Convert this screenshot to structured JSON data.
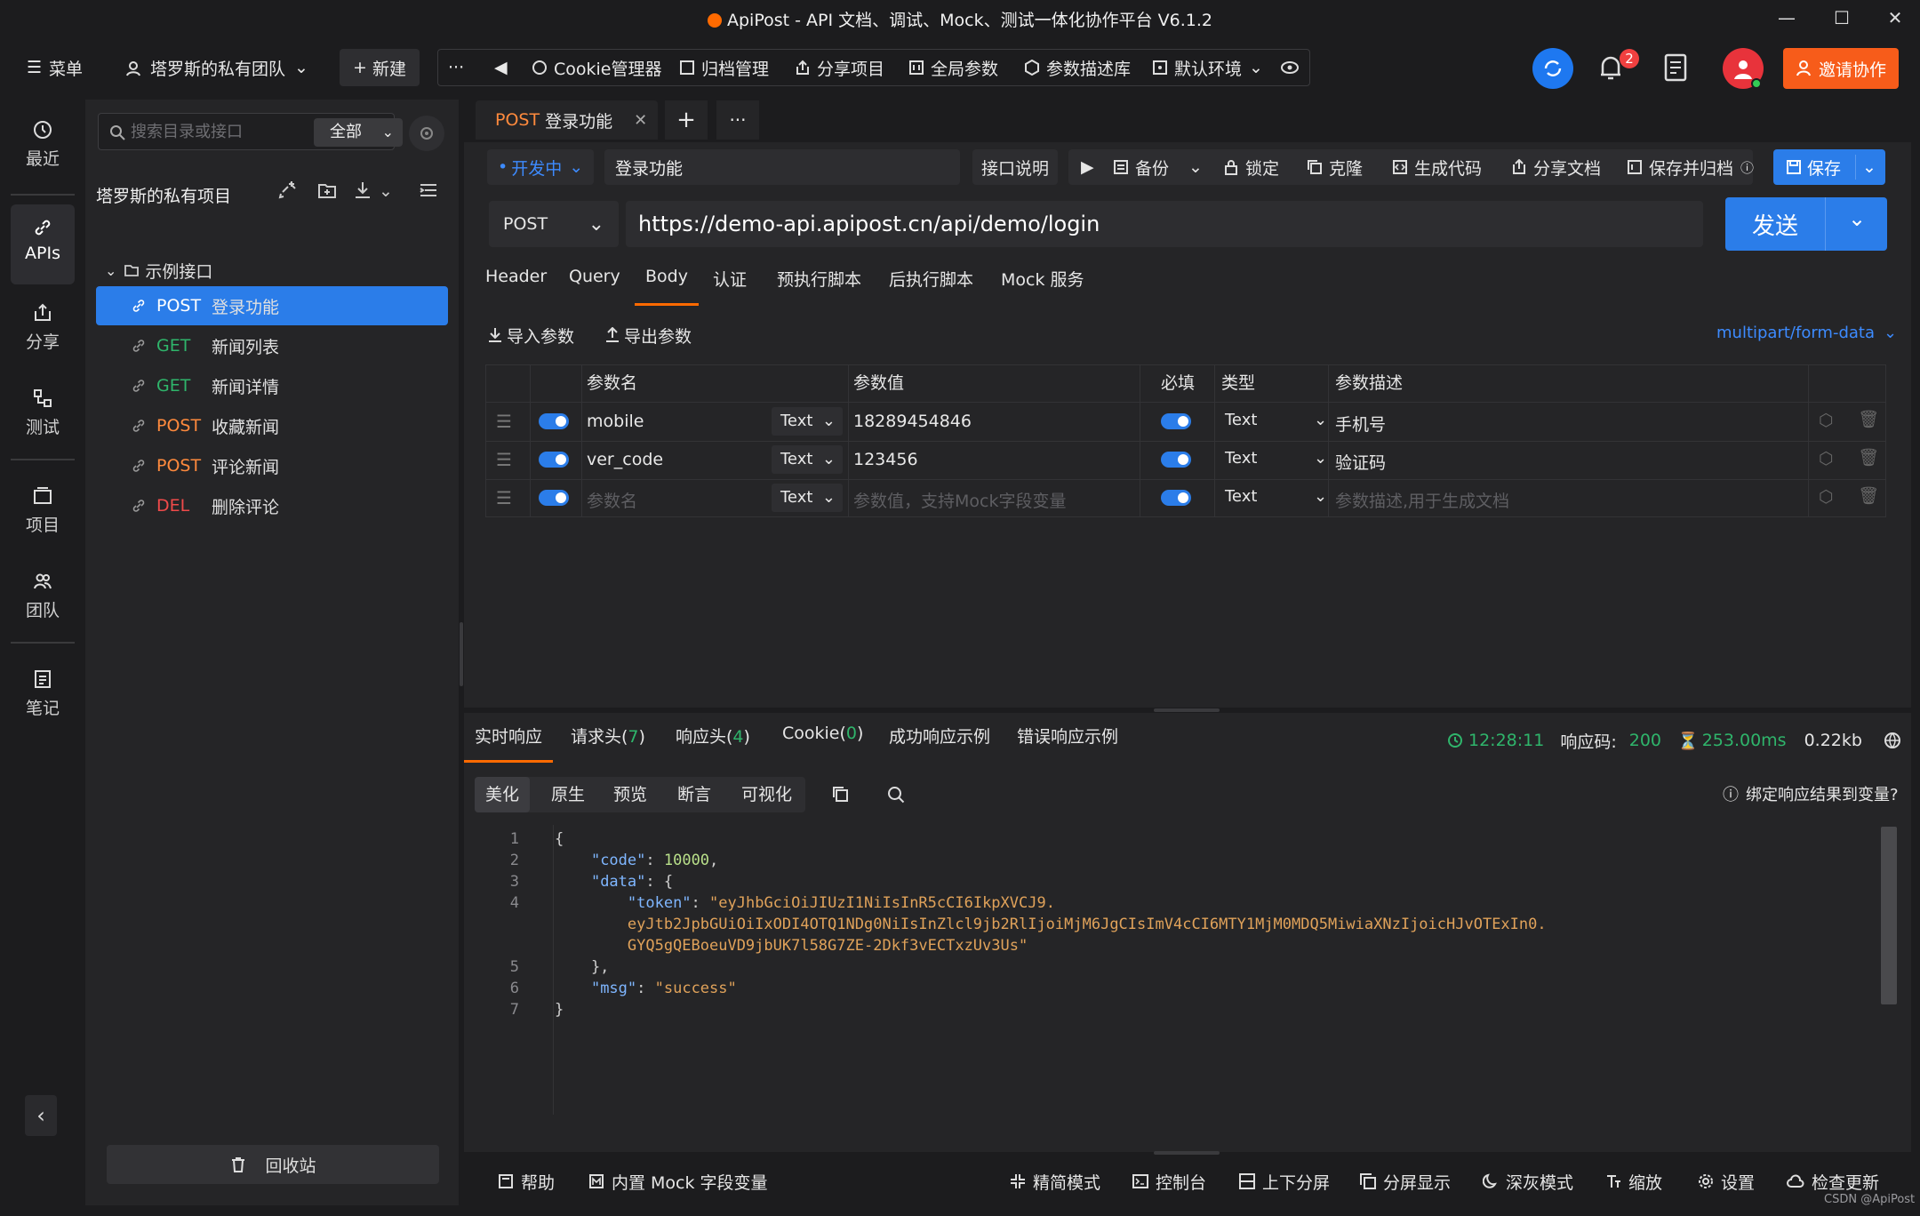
{
  "window": {
    "title": "ApiPost - API 文档、调试、Mock、测试一体化协作平台 V6.1.2",
    "minimize_icon": "minimize-icon",
    "maximize_icon": "maximize-icon",
    "close_icon": "close-icon"
  },
  "topbar": {
    "menu_label": "菜单",
    "team_label": "塔罗斯的私有团队",
    "new_label": "新建",
    "more_label": "···",
    "cookie_label": "Cookie管理器",
    "archive_label": "归档管理",
    "share_project_label": "分享项目",
    "global_params_label": "全局参数",
    "param_lib_label": "参数描述库",
    "env_label": "默认环境",
    "notification_count": "2",
    "invite_label": "邀请协作"
  },
  "leftnav": {
    "items": [
      {
        "label": "最近",
        "icon": "clock-icon"
      },
      {
        "label": "APIs",
        "icon": "link-icon"
      },
      {
        "label": "分享",
        "icon": "share-icon"
      },
      {
        "label": "测试",
        "icon": "test-icon"
      },
      {
        "label": "项目",
        "icon": "project-icon"
      },
      {
        "label": "团队",
        "icon": "team-icon"
      },
      {
        "label": "笔记",
        "icon": "note-icon"
      }
    ],
    "active": "APIs"
  },
  "sidebar": {
    "search_placeholder": "搜索目录或接口",
    "scope": "全部",
    "project_title": "塔罗斯的私有项目",
    "folder": "示例接口",
    "items": [
      {
        "method": "POST",
        "name": "登录功能"
      },
      {
        "method": "GET",
        "name": "新闻列表"
      },
      {
        "method": "GET",
        "name": "新闻详情"
      },
      {
        "method": "POST",
        "name": "收藏新闻"
      },
      {
        "method": "POST",
        "name": "评论新闻"
      },
      {
        "method": "DEL",
        "name": "删除评论"
      }
    ],
    "trash_label": "回收站"
  },
  "tabs": {
    "active_method": "POST",
    "active_name": "登录功能",
    "add_label": "+",
    "more_label": "···"
  },
  "request": {
    "status": "开发中",
    "name": "登录功能",
    "doc_label": "接口说明",
    "actions": {
      "backup": "备份",
      "lock": "锁定",
      "clone": "克隆",
      "gen_code": "生成代码",
      "share_doc": "分享文档",
      "save_archive": "保存并归档",
      "save": "保存"
    },
    "method": "POST",
    "url": "https://demo-api.apipost.cn/api/demo/login",
    "send_label": "发送",
    "param_tabs": [
      "Header",
      "Query",
      "Body",
      "认证",
      "预执行脚本",
      "后执行脚本",
      "Mock 服务"
    ],
    "active_param_tab": "Body",
    "import_label": "导入参数",
    "export_label": "导出参数",
    "content_type": "multipart/form-data",
    "table": {
      "headers": {
        "name": "参数名",
        "value": "参数值",
        "required": "必填",
        "type": "类型",
        "desc": "参数描述"
      },
      "rows": [
        {
          "name": "mobile",
          "field_type": "Text",
          "value": "18289454846",
          "type": "Text",
          "desc": "手机号"
        },
        {
          "name": "ver_code",
          "field_type": "Text",
          "value": "123456",
          "type": "Text",
          "desc": "验证码"
        }
      ],
      "placeholder_row": {
        "name_placeholder": "参数名",
        "field_type": "Text",
        "value_placeholder": "参数值，支持Mock字段变量",
        "type": "Text",
        "desc_placeholder": "参数描述,用于生成文档"
      }
    }
  },
  "response": {
    "tabs": {
      "realtime": "实时响应",
      "req_headers": "请求头(",
      "req_headers_count": "7",
      "resp_headers": "响应头(",
      "resp_headers_count": "4",
      "cookie": "Cookie(",
      "cookie_count": "0",
      "close_paren": ")",
      "success_example": "成功响应示例",
      "error_example": "错误响应示例"
    },
    "time": "12:28:11",
    "code_label": "响应码:",
    "code": "200",
    "duration": "253.00ms",
    "size": "0.22kb",
    "view_tabs": [
      "美化",
      "原生",
      "预览",
      "断言",
      "可视化"
    ],
    "active_view": "美化",
    "bind_label": "绑定响应结果到变量?",
    "code_lines": [
      {
        "no": "1",
        "text": "{"
      },
      {
        "no": "2",
        "text": "    \"code\": 10000,"
      },
      {
        "no": "3",
        "text": "    \"data\": {"
      },
      {
        "no": "4",
        "text": "        \"token\": \"eyJhbGciOiJIUzI1NiIsInR5cCI6IkpXVCJ9."
      },
      {
        "no": "",
        "text": "        eyJtb2JpbGUiOiIxODI4OTQ1NDg0NiIsInZlcl9jb2RlIjoiMjM6JgCIsImV4cCI6MTY1MjM0MDQ5MiwiaXNzIjoicHJvOTExIn0."
      },
      {
        "no": "",
        "text": "        GYQ5gQEBoeuVD9jbUK7l58G7ZE-2Dkf3vECTxzUv3Us\""
      },
      {
        "no": "5",
        "text": "    },"
      },
      {
        "no": "6",
        "text": "    \"msg\": \"success\""
      },
      {
        "no": "7",
        "text": "}"
      }
    ]
  },
  "footer": {
    "help": "帮助",
    "mock_vars": "内置 Mock 字段变量",
    "simple_mode": "精简模式",
    "console": "控制台",
    "split_vertical": "上下分屏",
    "split_display": "分屏显示",
    "dark_mode": "深灰模式",
    "zoom": "缩放",
    "settings": "设置",
    "check_update": "检查更新",
    "watermark": "CSDN @ApiPost"
  },
  "colors": {
    "accent": "#2b7de9",
    "brand_orange": "#ff6a00",
    "post": "#ff8a3d",
    "get": "#2fb56b",
    "del": "#f04a4a",
    "bg": "#1c1c1e",
    "panel": "#252527"
  }
}
